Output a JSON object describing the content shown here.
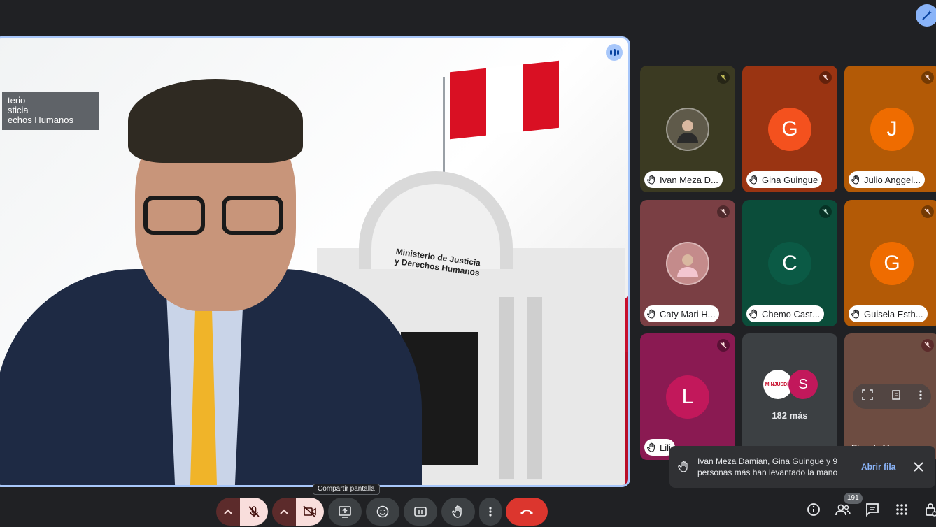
{
  "main_speaker": {
    "background_sign_lines": [
      "terio",
      "sticia",
      "echos Humanos"
    ],
    "building_sign": [
      "Ministerio de Justicia",
      "y Derechos Humanos"
    ]
  },
  "participants": [
    {
      "name": "Ivan Meza D...",
      "initial": "",
      "bg": "#3b3a22",
      "avatar_color": "#5f5a4a",
      "photo": true,
      "mic_color": "#c6c15b"
    },
    {
      "name": "Gina Guingue",
      "initial": "G",
      "bg": "#9a3412",
      "avatar_color": "#f4511e",
      "photo": false,
      "mic_color": "#f9dedc"
    },
    {
      "name": "Julio Anggel...",
      "initial": "J",
      "bg": "#b35a06",
      "avatar_color": "#ef6c00",
      "photo": false,
      "mic_color": "#f9dedc"
    },
    {
      "name": "Caty Mari H...",
      "initial": "",
      "bg": "#7a3f44",
      "avatar_color": "#c48b8b",
      "photo": true,
      "mic_color": "#f9dedc"
    },
    {
      "name": "Chemo Cast...",
      "initial": "C",
      "bg": "#0b4d3a",
      "avatar_color": "#0b5a45",
      "photo": false,
      "mic_color": "#c2e7d9"
    },
    {
      "name": "Guisela Esth...",
      "initial": "G",
      "bg": "#b35a06",
      "avatar_color": "#ef6c00",
      "photo": false,
      "mic_color": "#f9dedc"
    },
    {
      "name": "Lili",
      "initial": "L",
      "bg": "#8a1a52",
      "avatar_color": "#c2185b",
      "photo": false,
      "mic_color": "#f9dedc"
    }
  ],
  "more_tile": {
    "count_label": "182 más",
    "mini_initial": "S",
    "mini_logo_text": "MINJUSDH"
  },
  "last_tile": {
    "name": "Ricardo Mont..."
  },
  "toast": {
    "message": "Ivan Meza Damian, Gina Guingue y 9 personas más han levantado la mano",
    "action": "Abrir fila"
  },
  "tooltip": "Compartir pantalla",
  "participant_count": "191",
  "colors": {
    "background": "#202124",
    "active_border": "#a8c7fa",
    "end_call": "#dc362e",
    "link": "#8ab4f8"
  }
}
